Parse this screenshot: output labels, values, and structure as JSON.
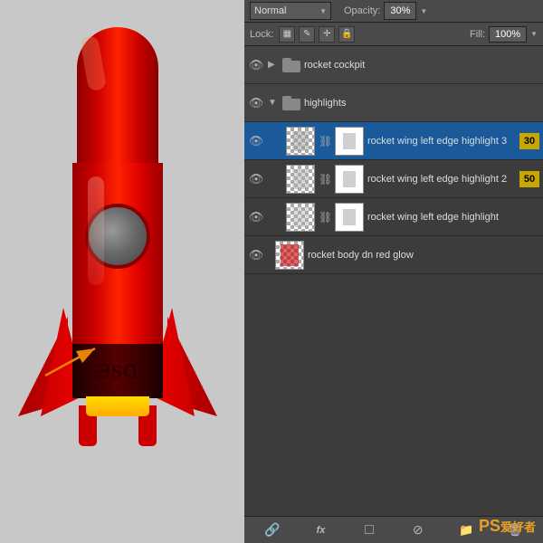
{
  "canvas": {
    "background": "#c8c8c8"
  },
  "blend_mode": {
    "label": "Normal",
    "value": "Normal"
  },
  "opacity": {
    "label": "Opacity:",
    "value": "30%"
  },
  "lock": {
    "label": "Lock:",
    "icons": [
      "☑",
      "✏",
      "⬛",
      "🔒"
    ],
    "fill_label": "Fill:",
    "fill_value": "100%"
  },
  "layers": [
    {
      "id": "group-rocket-cockpit",
      "type": "group",
      "visible": true,
      "name": "rocket cockpit",
      "indent": 0,
      "badge": null,
      "expanded": false
    },
    {
      "id": "group-highlights",
      "type": "group",
      "visible": true,
      "name": "highlights",
      "indent": 0,
      "badge": null,
      "expanded": true
    },
    {
      "id": "layer-highlight3",
      "type": "layer",
      "visible": true,
      "name": "rocket wing left edge  highlight 3",
      "indent": 1,
      "badge": "30",
      "selected": true
    },
    {
      "id": "layer-highlight2",
      "type": "layer",
      "visible": true,
      "name": "rocket wing left edge  highlight 2",
      "indent": 1,
      "badge": "50",
      "selected": false
    },
    {
      "id": "layer-highlight1",
      "type": "layer",
      "visible": true,
      "name": "rocket wing left edge highlight",
      "indent": 1,
      "badge": null,
      "selected": false
    },
    {
      "id": "layer-body-glow",
      "type": "layer",
      "visible": true,
      "name": "rocket body dn red glow",
      "indent": 0,
      "badge": null,
      "selected": false
    }
  ],
  "bottombar": {
    "icons": [
      "🔗",
      "fx",
      "□",
      "⊘",
      "📁",
      "🗑"
    ]
  },
  "watermark": {
    "ps": "PS",
    "rest": "爱好者"
  },
  "rocket": {
    "ps_text": "ᗰSᗡ"
  }
}
